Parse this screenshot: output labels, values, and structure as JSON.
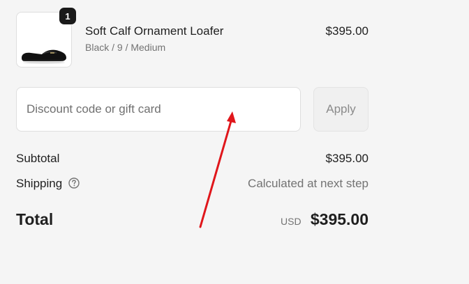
{
  "line_item": {
    "quantity": "1",
    "name": "Soft Calf Ornament Loafer",
    "variant": "Black / 9 / Medium",
    "price": "$395.00",
    "image_icon": "black-loafer-shoe"
  },
  "discount": {
    "placeholder": "Discount code or gift card",
    "value": "",
    "apply_label": "Apply"
  },
  "summary": {
    "subtotal_label": "Subtotal",
    "subtotal_value": "$395.00",
    "shipping_label": "Shipping",
    "shipping_help_icon": "question-circle-icon",
    "shipping_value": "Calculated at next step",
    "total_label": "Total",
    "total_currency": "USD",
    "total_value": "$395.00"
  },
  "colors": {
    "background": "#f5f5f5",
    "text": "#1f1f1f",
    "muted_text": "#737373",
    "annotation_arrow": "#e0161b"
  }
}
